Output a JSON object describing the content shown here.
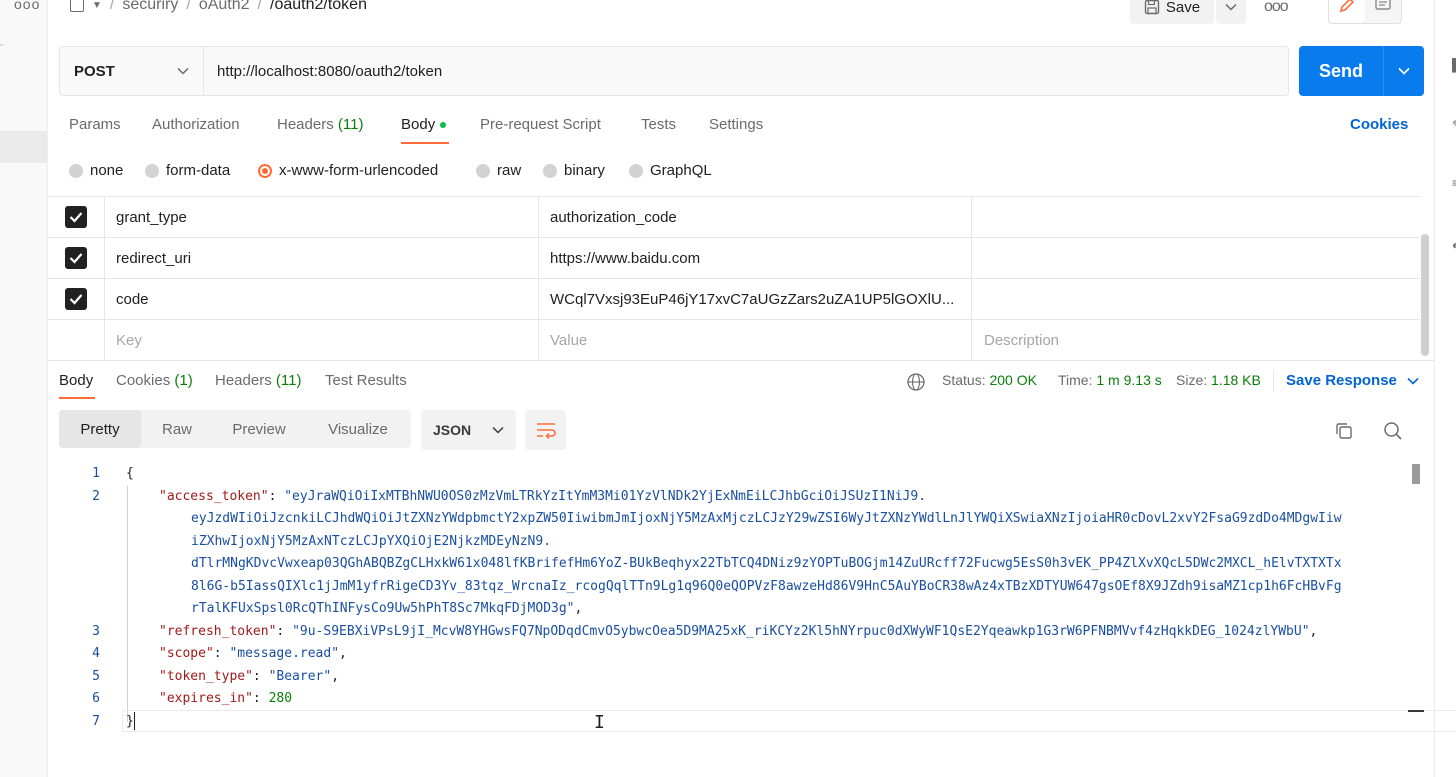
{
  "sidebar": {
    "more_label": "ooo",
    "fragment": "-"
  },
  "breadcrumb": {
    "items": [
      "securiry",
      "oAuth2"
    ],
    "current": "/oauth2/token",
    "separator": "/"
  },
  "toolbar": {
    "save_label": "Save",
    "more_label": "ooo"
  },
  "request": {
    "method": "POST",
    "url": "http://localhost:8080/oauth2/token",
    "send_label": "Send"
  },
  "request_tabs": {
    "params": "Params",
    "authorization": "Authorization",
    "headers": "Headers",
    "headers_count": "(11)",
    "body": "Body",
    "prerequest": "Pre-request Script",
    "tests": "Tests",
    "settings": "Settings",
    "cookies": "Cookies"
  },
  "body_types": {
    "none": "none",
    "form_data": "form-data",
    "urlencoded": "x-www-form-urlencoded",
    "raw": "raw",
    "binary": "binary",
    "graphql": "GraphQL",
    "selected": "x-www-form-urlencoded"
  },
  "params_table": {
    "rows": [
      {
        "checked": true,
        "key": "grant_type",
        "value": "authorization_code",
        "description": ""
      },
      {
        "checked": true,
        "key": "redirect_uri",
        "value": "https://www.baidu.com",
        "description": ""
      },
      {
        "checked": true,
        "key": "code",
        "value": "WCql7Vxsj93EuP46jY17xvC7aUGzZars2uZA1UP5lGOXlU...",
        "description": ""
      }
    ],
    "placeholder": {
      "key": "Key",
      "value": "Value",
      "description": "Description"
    }
  },
  "response_tabs": {
    "body": "Body",
    "cookies": "Cookies",
    "cookies_count": "(1)",
    "headers": "Headers",
    "headers_count": "(11)",
    "test_results": "Test Results"
  },
  "response_meta": {
    "status_label": "Status:",
    "status_value": "200 OK",
    "time_label": "Time:",
    "time_value": "1 m 9.13 s",
    "size_label": "Size:",
    "size_value": "1.18 KB",
    "save_response": "Save Response"
  },
  "view_modes": {
    "pretty": "Pretty",
    "raw": "Raw",
    "preview": "Preview",
    "visualize": "Visualize",
    "format": "JSON"
  },
  "response_json": {
    "access_token_key": "\"access_token\"",
    "access_token_lines": [
      "\"eyJraWQiOiIxMTBhNWU0OS0zMzVmLTRkYzItYmM3Mi01YzVlNDk2YjExNmEiLCJhbGciOiJSUzI1NiJ9.",
      "eyJzdWIiOiJzcnkiLCJhdWQiOiJtZXNzYWdpbmctY2xpZW50IiwibmJmIjoxNjY5MzAxMjczLCJzY29wZSI6WyJtZXNzYWdlLnJlYWQiXSwiaXNzIjoiaHR0cDovL2xvY2FsaG9zdDo4MDgwIiw",
      "iZXhwIjoxNjY5MzAxNTczLCJpYXQiOjE2NjkzMDEyNzN9.",
      "dTlrMNgKDvcVwxeap03QGhABQBZgCLHxkW61x048lfKBrifefHm6YoZ-BUkBeqhyx22TbTCQ4DNiz9zYOPTuBOGjm14ZuURcff72Fucwg5EsS0h3vEK_PP4ZlXvXQcL5DWc2MXCL_hElvTXTXTx",
      "8l6G-b5IassQIXlc1jJmM1yfrRigeCD3Yv_83tqz_WrcnaIz_rcogQqlTTn9Lg1q96Q0eQOPVzF8awzeHd86V9HnC5AuYBoCR38wAz4xTBzXDTYUW647gsOEf8X9JZdh9isaMZ1cp1h6FcHBvFg",
      "rTalKFUxSpsl0RcQThINFysCo9Uw5hPhT8Sc7MkqFDjMOD3g\""
    ],
    "refresh_token_key": "\"refresh_token\"",
    "refresh_token_value": "\"9u-S9EBXiVPsL9jI_McvW8YHGwsFQ7NpODqdCmvO5ybwcOea5D9MA25xK_riKCYz2Kl5hNYrpuc0dXWyWF1QsE2Yqeawkp1G3rW6PFNBMVvf4zHqkkDEG_1024zlYWbU\"",
    "scope_key": "\"scope\"",
    "scope_value": "\"message.read\"",
    "token_type_key": "\"token_type\"",
    "token_type_value": "\"Bearer\"",
    "expires_in_key": "\"expires_in\"",
    "expires_in_value": "280",
    "open_brace": "{",
    "close_brace": "}",
    "line_numbers": [
      "1",
      "2",
      "3",
      "4",
      "5",
      "6",
      "7"
    ]
  },
  "colors": {
    "accent": "#ff6c37",
    "primary": "#097bed",
    "link": "#0265d2",
    "success": "#0a7e0a"
  }
}
